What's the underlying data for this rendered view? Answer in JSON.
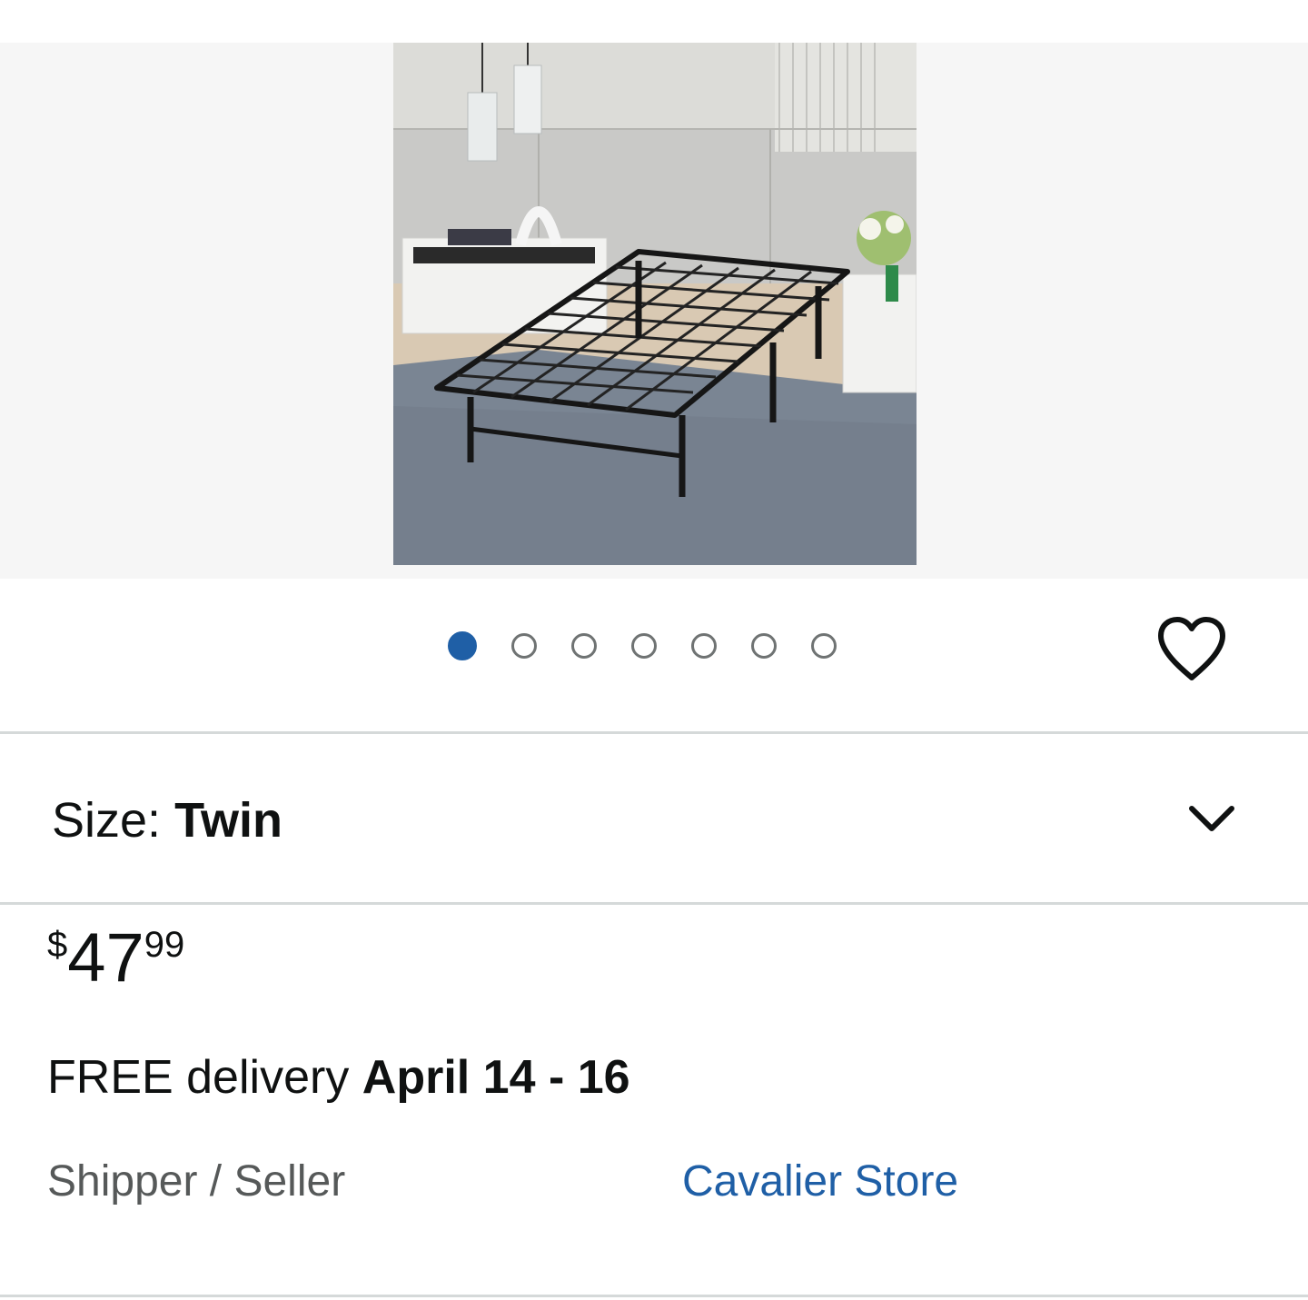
{
  "gallery": {
    "image_alt": "Black metal twin bed frame in bedroom",
    "dot_count": 7,
    "active_index": 0,
    "accent_color": "#1f5fa6"
  },
  "wishlist": {
    "icon": "heart-icon"
  },
  "size_selector": {
    "label": "Size: ",
    "value": "Twin",
    "icon": "chevron-down-icon"
  },
  "price": {
    "symbol": "$",
    "whole": "47",
    "fraction": "99"
  },
  "delivery": {
    "prefix": "FREE delivery ",
    "dates": "April 14 - 16"
  },
  "shipper": {
    "label": "Shipper / Seller",
    "value": "Cavalier Store",
    "link_color": "#1f5fa6"
  }
}
